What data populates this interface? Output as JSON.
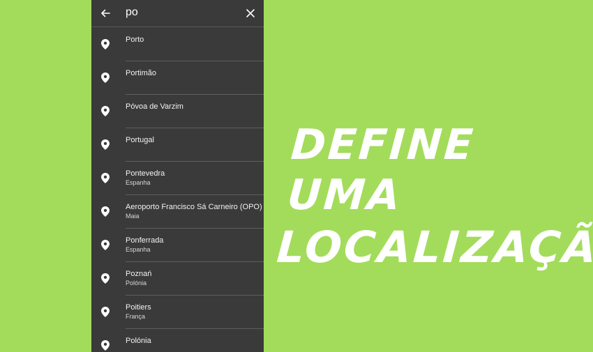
{
  "search": {
    "query": "po",
    "back_icon": "arrow-left-icon",
    "clear_icon": "close-icon"
  },
  "results": [
    {
      "title": "Porto",
      "subtitle": ""
    },
    {
      "title": "Portimão",
      "subtitle": ""
    },
    {
      "title": "Póvoa de Varzim",
      "subtitle": ""
    },
    {
      "title": "Portugal",
      "subtitle": ""
    },
    {
      "title": "Pontevedra",
      "subtitle": "Espanha"
    },
    {
      "title": "Aeroporto Francisco Sá Carneiro (OPO)",
      "subtitle": "Maia"
    },
    {
      "title": "Ponferrada",
      "subtitle": "Espanha"
    },
    {
      "title": "Poznań",
      "subtitle": "Polónia"
    },
    {
      "title": "Poitiers",
      "subtitle": "França"
    },
    {
      "title": "Polónia",
      "subtitle": ""
    }
  ],
  "result_icon": "location-pin-icon",
  "headline": {
    "line1": "DEFINE UMA",
    "line2": "LOCALIZAÇÃO"
  },
  "colors": {
    "background": "#a3dc5b",
    "panel": "#3a3a3a",
    "text": "#ffffff"
  }
}
